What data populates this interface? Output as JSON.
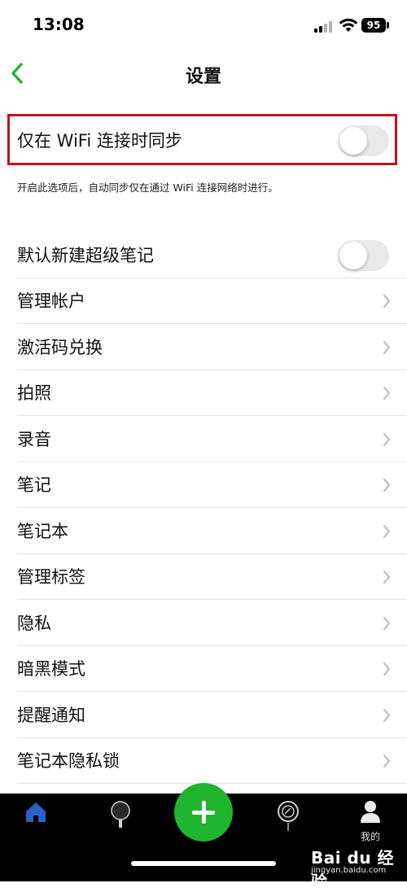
{
  "status_bar": {
    "time": "13:08",
    "battery": "95"
  },
  "header": {
    "title": "设置"
  },
  "wifi_sync": {
    "label": "仅在 WiFi 连接时同步",
    "enabled": false,
    "hint": "开启此选项后，自动同步仅在通过 WiFi 连接网络时进行。"
  },
  "settings": [
    {
      "label": "默认新建超级笔记",
      "control": "toggle",
      "enabled": false
    },
    {
      "label": "管理帐户",
      "control": "chevron"
    },
    {
      "label": "激活码兑换",
      "control": "chevron"
    },
    {
      "label": "拍照",
      "control": "chevron"
    },
    {
      "label": "录音",
      "control": "chevron"
    },
    {
      "label": "笔记",
      "control": "chevron"
    },
    {
      "label": "笔记本",
      "control": "chevron"
    },
    {
      "label": "管理标签",
      "control": "chevron"
    },
    {
      "label": "隐私",
      "control": "chevron"
    },
    {
      "label": "暗黑模式",
      "control": "chevron"
    },
    {
      "label": "提醒通知",
      "control": "chevron"
    },
    {
      "label": "笔记本隐私锁",
      "control": "chevron"
    }
  ],
  "tab_bar": {
    "tabs": [
      {
        "icon": "home-icon",
        "label": ""
      },
      {
        "icon": "idea-icon",
        "label": ""
      },
      {
        "icon": "add-icon",
        "label": ""
      },
      {
        "icon": "explore-icon",
        "label": ""
      },
      {
        "icon": "user-icon",
        "label": "我的"
      }
    ]
  },
  "watermark": {
    "brand": "Bai du 经验",
    "url": "jingyan.baidu.com"
  },
  "colors": {
    "accent": "#1fb52e",
    "highlight": "#c4111b",
    "tab_bar": "#000000"
  }
}
